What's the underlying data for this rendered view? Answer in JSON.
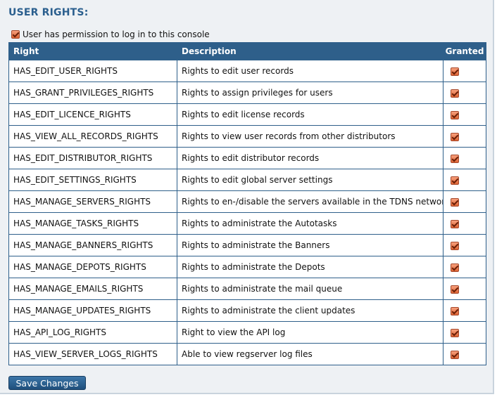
{
  "section_title": "USER RIGHTS:",
  "login_permission": {
    "label": "User has permission to log in to this console",
    "checked": true
  },
  "table": {
    "headers": {
      "right": "Right",
      "description": "Description",
      "granted": "Granted"
    },
    "rows": [
      {
        "right": "HAS_EDIT_USER_RIGHTS",
        "description": "Rights to edit user records",
        "granted": true
      },
      {
        "right": "HAS_GRANT_PRIVILEGES_RIGHTS",
        "description": "Rights to assign privileges for users",
        "granted": true
      },
      {
        "right": "HAS_EDIT_LICENCE_RIGHTS",
        "description": "Rights to edit license records",
        "granted": true
      },
      {
        "right": "HAS_VIEW_ALL_RECORDS_RIGHTS",
        "description": "Rights to view user records from other distributors",
        "granted": true
      },
      {
        "right": "HAS_EDIT_DISTRIBUTOR_RIGHTS",
        "description": "Rights to edit distributor records",
        "granted": true
      },
      {
        "right": "HAS_EDIT_SETTINGS_RIGHTS",
        "description": "Rights to edit global server settings",
        "granted": true
      },
      {
        "right": "HAS_MANAGE_SERVERS_RIGHTS",
        "description": "Rights to en-/disable the servers available in the TDNS network",
        "granted": true
      },
      {
        "right": "HAS_MANAGE_TASKS_RIGHTS",
        "description": "Rights to administrate the Autotasks",
        "granted": true
      },
      {
        "right": "HAS_MANAGE_BANNERS_RIGHTS",
        "description": "Rights to administrate the Banners",
        "granted": true
      },
      {
        "right": "HAS_MANAGE_DEPOTS_RIGHTS",
        "description": "Rights to administrate the Depots",
        "granted": true
      },
      {
        "right": "HAS_MANAGE_EMAILS_RIGHTS",
        "description": "Rights to administrate the mail queue",
        "granted": true
      },
      {
        "right": "HAS_MANAGE_UPDATES_RIGHTS",
        "description": "Rights to administrate the client updates",
        "granted": true
      },
      {
        "right": "HAS_API_LOG_RIGHTS",
        "description": "Right to view the API log",
        "granted": true
      },
      {
        "right": "HAS_VIEW_SERVER_LOGS_RIGHTS",
        "description": "Able to view regserver log files",
        "granted": true
      }
    ]
  },
  "save_button": {
    "label": "Save Changes"
  },
  "colors": {
    "header_bg": "#2e5f8a",
    "title": "#2b5f8e",
    "checkbox": "#dd6433",
    "button": "#2e5f8a"
  },
  "icons": {
    "checkbox": "checkbox-checked-icon"
  }
}
